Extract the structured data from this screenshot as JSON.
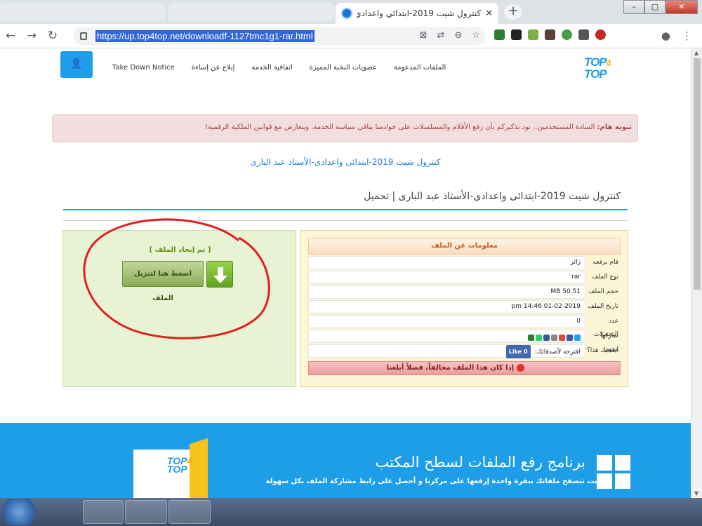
{
  "browser": {
    "active_tab_title": "كنترول شيت 2019-ابتدائي واعدادي-الأستا",
    "url": "https://up.top4top.net/downloadf-1127tmc1g1-rar.html",
    "new_tab": "+",
    "close_tab": "✕",
    "window_buttons": {
      "minimize": "–",
      "maximize": "▢",
      "close": "✕"
    }
  },
  "site": {
    "nav_links": [
      "Take Down Notice",
      "إبلاغ عن إساءة",
      "اتفاقية الخدمة",
      "عضويات النخبة المميزة",
      "الملفات المدعومة"
    ],
    "logo": {
      "top1": "TOP",
      "four": "4",
      "top2": "TOP"
    },
    "user_icon": "👤"
  },
  "alert": {
    "bold": "تنويه هام:",
    "text": " السادة المستخدمين.. نود تذكيركم بأن رفع الأفلام والمسلسلات على خوادمنا ينافي سياسة الخدمة، ويتعارض مع قوانين الملكية الرقمية!"
  },
  "file_link": "كنترول شيت 2019-ابتدائى واعدادى-الأستاذ عبد البارى",
  "page_title": "كنترول شيت 2019-ابتدائى واعدادى-الأستاذ عبد البارى | تحميل",
  "download": {
    "found_text": "[ تم إيجاد الملف ]",
    "button_label": "اضغط هنا لتنزيل الملف"
  },
  "info": {
    "heading": "معلومات عن الملف",
    "rows": [
      {
        "label": "قام برفعه",
        "value": "زائر"
      },
      {
        "label": "نوع الملف",
        "value": "rar"
      },
      {
        "label": "حجم الملف",
        "value": "MB 50.51"
      },
      {
        "label": "تاريخ الملف",
        "value": "pm 14:46 01-02-2019"
      },
      {
        "label": "عدد التحميلات",
        "value": "0"
      },
      {
        "label": "شاركها معهم",
        "value": ""
      },
      {
        "label": "أيعجبك هذا؟",
        "value": "اقترحه لأصدقائك:"
      }
    ],
    "like_label": "Like 0",
    "report_text": "إذا كان هذا الملف مخالفاً، فضلاً أبلغنا"
  },
  "footer": {
    "title": "برنامج رفع الملفات لسطح المكتب",
    "subtitle": "و أنت تتصفح ملفاتك بنقرة واحدة إرفعها على مركزنا و أحصل على رابط مشاركة الملف بكل سهولة"
  },
  "colors": {
    "accent": "#1e9ee8",
    "alert_bg": "#f2dede",
    "green_box": "#e8f3d3",
    "info_box": "#fdf6d6"
  }
}
